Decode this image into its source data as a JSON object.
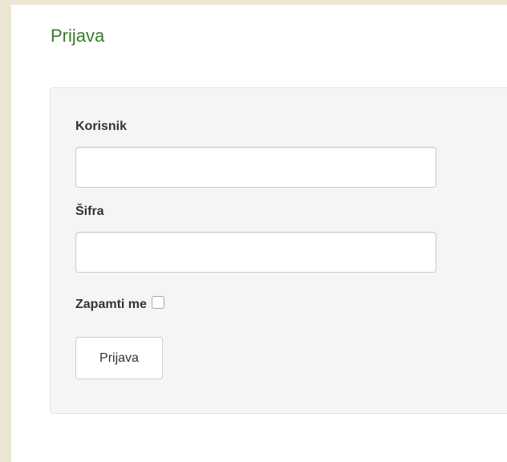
{
  "page": {
    "title": "Prijava"
  },
  "form": {
    "username_label": "Korisnik",
    "username_value": "",
    "password_label": "Šifra",
    "password_value": "",
    "remember_label": "Zapamti me",
    "remember_checked": false,
    "submit_label": "Prijava"
  },
  "colors": {
    "page_background": "#ebe7d4",
    "title": "#3c7a32",
    "panel_background": "#f5f5f5",
    "input_border": "#cccccc",
    "text": "#333333"
  }
}
